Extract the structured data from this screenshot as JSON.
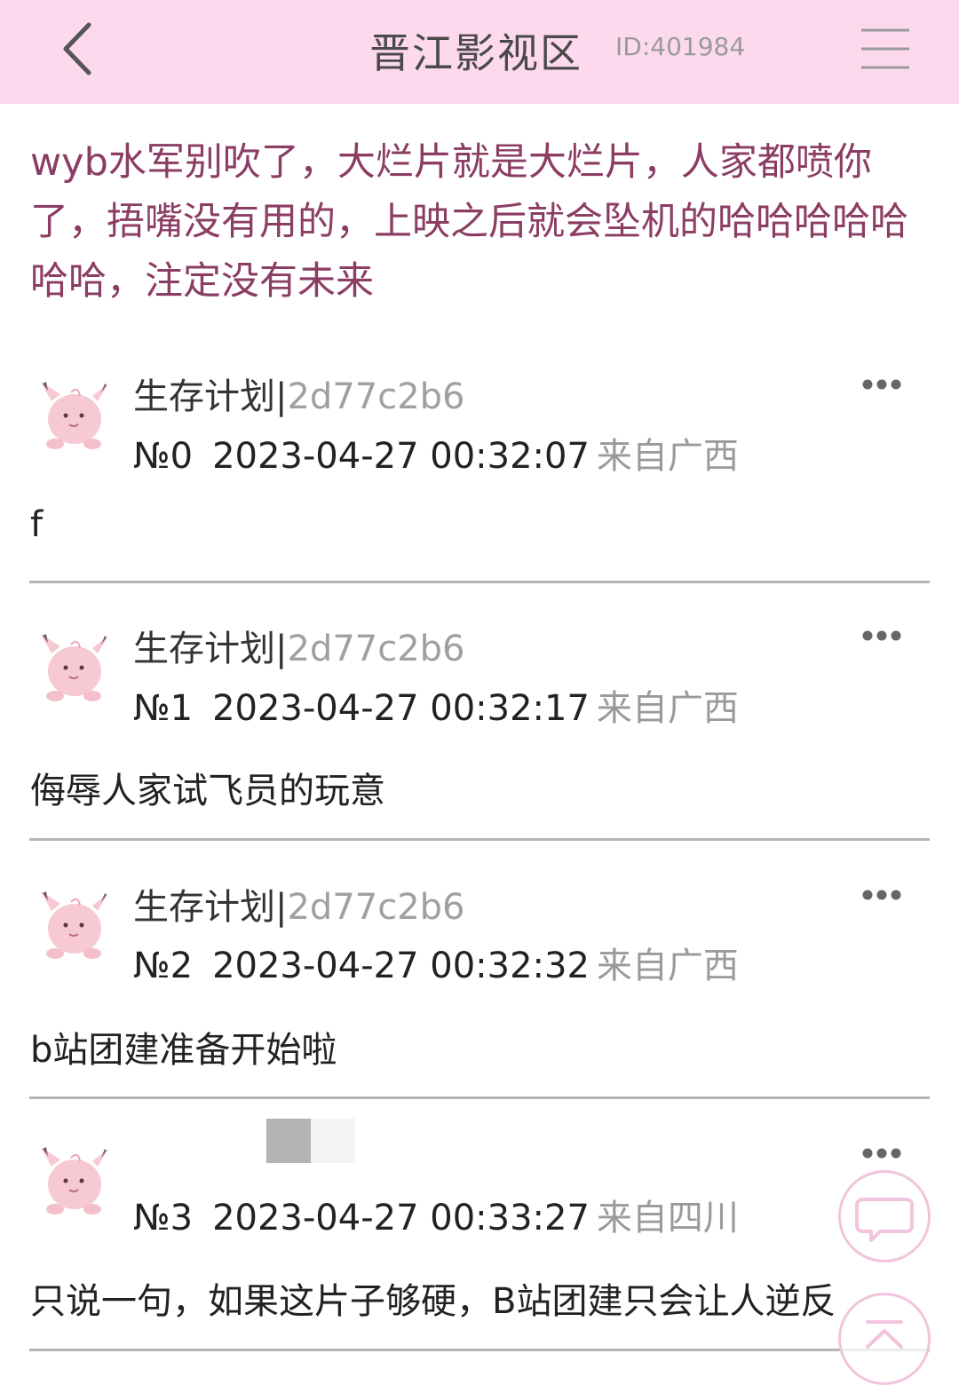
{
  "header": {
    "title": "晋江影视区",
    "id_text": "ID:401984",
    "back_icon": "chevron-left-icon",
    "menu_icon": "hamburger-menu-icon"
  },
  "post": {
    "title": "wyb水军别吹了，大烂片就是大烂片，人家都喷你了，捂嘴没有用的，上映之后就会坠机的哈哈哈哈哈哈哈，注定没有未来"
  },
  "replies": [
    {
      "name": "生存计划|",
      "uid": "2d77c2b6",
      "floor": "№0",
      "time": "2023-04-27 00:32:07",
      "location": "来自广西",
      "content": "f"
    },
    {
      "name": "生存计划|",
      "uid": "2d77c2b6",
      "floor": "№1",
      "time": "2023-04-27 00:32:17",
      "location": "来自广西",
      "content": "侮辱人家试飞员的玩意"
    },
    {
      "name": "生存计划|",
      "uid": "2d77c2b6",
      "floor": "№2",
      "time": "2023-04-27 00:32:32",
      "location": "来自广西",
      "content": "b站团建准备开始啦"
    },
    {
      "name": "",
      "uid": "",
      "floor": "№3",
      "time": "2023-04-27 00:33:27",
      "location": "来自四川",
      "content": "只说一句，如果这片子够硬，B站团建只会让人逆反"
    }
  ],
  "colors": {
    "header_bg": "#fdd9ee",
    "title_color": "#8b3d63",
    "accent_pink": "#f2c4dd"
  },
  "icons": {
    "avatar": "clefairy-avatar-icon",
    "more": "more-dots-icon",
    "comment": "comment-bubble-icon",
    "scroll_top": "scroll-to-top-icon"
  }
}
